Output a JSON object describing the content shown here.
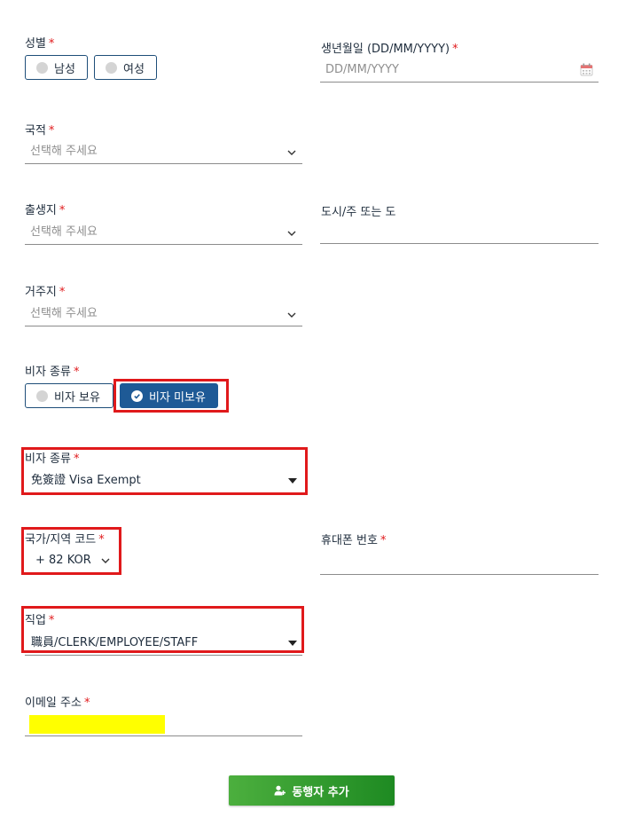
{
  "gender": {
    "label": "성별",
    "required": "*",
    "options": [
      "남성",
      "여성"
    ]
  },
  "birthdate": {
    "label": "생년월일 (DD/MM/YYYY)",
    "required": "*",
    "placeholder": "DD/MM/YYYY",
    "icon": "calendar-icon"
  },
  "nationality": {
    "label": "국적",
    "required": "*",
    "placeholder": "선택해 주세요"
  },
  "birthplace": {
    "label": "출생지",
    "required": "*",
    "placeholder": "선택해 주세요"
  },
  "city_province": {
    "label": "도시/주 또는 도"
  },
  "residence": {
    "label": "거주지",
    "required": "*",
    "placeholder": "선택해 주세요"
  },
  "visa_status": {
    "label": "비자 종류",
    "required": "*",
    "options": [
      "비자 보유",
      "비자 미보유"
    ],
    "selected": "비자 미보유"
  },
  "visa_type": {
    "label": "비자 종류",
    "required": "*",
    "value": "免簽證 Visa Exempt"
  },
  "country_code": {
    "label": "국가/지역 코드",
    "required": "*",
    "value": "+ 82 KOR"
  },
  "mobile": {
    "label": "휴대폰 번호",
    "required": "*"
  },
  "occupation": {
    "label": "직업",
    "required": "*",
    "value": "職員/CLERK/EMPLOYEE/STAFF"
  },
  "email": {
    "label": "이메일 주소",
    "required": "*"
  },
  "add_companion": {
    "label": "동행자 추가",
    "icon": "add-user-icon"
  },
  "colors": {
    "primary": "#1e5a96",
    "required": "#e0191b",
    "highlight_box": "#e0191b",
    "redaction": "#ffff00",
    "button_green": "#2e9a2c"
  }
}
